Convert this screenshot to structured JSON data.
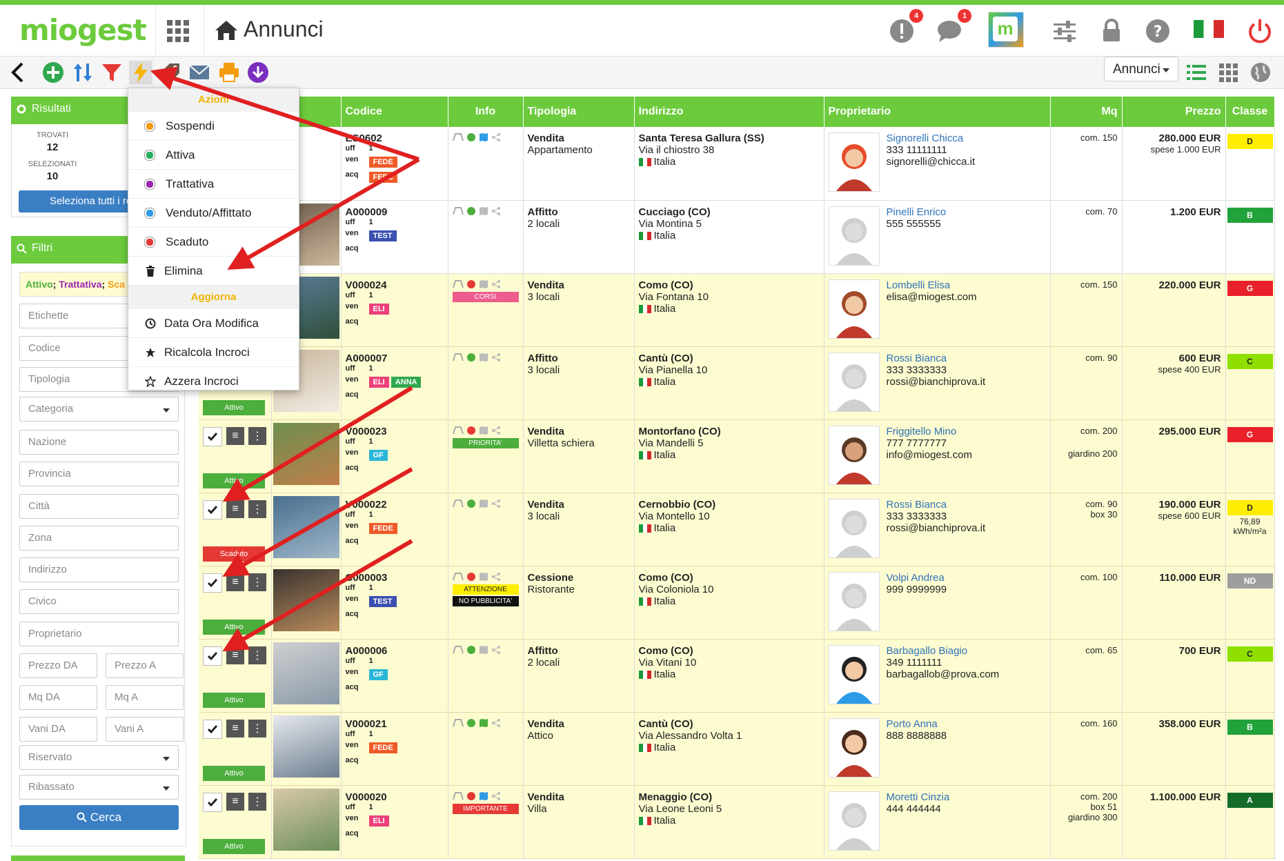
{
  "app": {
    "logo": "miogest",
    "page_title": "Annunci"
  },
  "header": {
    "alerts_badge": "4",
    "messages_badge": "1"
  },
  "toolbar": {
    "view_select": "Annunci"
  },
  "results": {
    "title": "Risultati",
    "found_label": "TROVATI",
    "found_value": "12",
    "selected_label": "SELEZIONATI",
    "selected_value": "10",
    "select_all_button": "Seleziona tutti i recor"
  },
  "filters": {
    "title": "Filtri",
    "states_active": "Attivo",
    "states_sep1": "; ",
    "states_trattativa": "Trattativa",
    "states_sep2": "; ",
    "states_scaduto": "Sca",
    "etichette": "Etichette",
    "codice": "Codice",
    "tipologia": "Tipologia",
    "categoria": "Categoria",
    "nazione": "Nazione",
    "provincia": "Provincia",
    "citta": "Città",
    "zona": "Zona",
    "indirizzo": "Indirizzo",
    "civico": "Civico",
    "proprietario": "Proprietario",
    "prezzo_da": "Prezzo DA",
    "prezzo_a": "Prezzo A",
    "mq_da": "Mq DA",
    "mq_a": "Mq A",
    "vani_da": "Vani DA",
    "vani_a": "Vani A",
    "riservato": "Riservato",
    "ribassato": "Ribassato",
    "search_button": "Cerca"
  },
  "dropdown": {
    "azioni_header": "Azioni",
    "items": [
      {
        "label": "Sospendi",
        "color": "#f39c12"
      },
      {
        "label": "Attiva",
        "color": "#27ae60"
      },
      {
        "label": "Trattativa",
        "color": "#9b27b0"
      },
      {
        "label": "Venduto/Affittato",
        "color": "#2e9be6"
      },
      {
        "label": "Scaduto",
        "color": "#e53935"
      },
      {
        "label": "Elimina"
      }
    ],
    "aggiorna_header": "Aggiorna",
    "aggiorna_items": [
      "Data Ora Modifica",
      "Ricalcola Incroci",
      "Azzera Incroci"
    ]
  },
  "table": {
    "columns": [
      "Foto",
      "Codice",
      "Info",
      "Tipologia",
      "Indirizzo",
      "Proprietario",
      "Mq",
      "Prezzo",
      "Classe"
    ],
    "uff_label": "uff",
    "ven_label": "ven",
    "acq_label": "acq",
    "rows": [
      {
        "code": "ES0602",
        "uff": "1",
        "ven_tag": "FEDE",
        "ven_color": "#f05a28",
        "acq_tag": "FEDE",
        "info_label": "",
        "tipo": "Vendita",
        "sub": "Appartamento",
        "city": "Santa Teresa Gallura (SS)",
        "street": "Via il chiostro 38",
        "country": "Italia",
        "owner": "Signorelli Chicca",
        "phone": "333 11111111",
        "email": "signorelli@chicca.it",
        "mq1": "com. 150",
        "mq2": "",
        "price": "280.000 EUR",
        "price2": "spese 1.000 EUR",
        "classe": "D",
        "classe_color": "#ffee00",
        "classe_text": "#222",
        "state": "",
        "white": true
      },
      {
        "code": "A000009",
        "uff": "1",
        "ven_tag": "TEST",
        "ven_color": "#3a4fb0",
        "acq_tag": "",
        "info_label": "",
        "tipo": "Affitto",
        "sub": "2 locali",
        "city": "Cucciago (CO)",
        "street": "Via Montina 5",
        "country": "Italia",
        "owner": "Pinelli Enrico",
        "phone": "555 555555",
        "email": "",
        "mq1": "com. 70",
        "mq2": "",
        "price": "1.200 EUR",
        "price2": "",
        "classe": "B",
        "classe_color": "#22a23a",
        "classe_text": "#fff",
        "state": "",
        "white": true
      },
      {
        "code": "V000024",
        "uff": "1",
        "ven_tag": "ELI",
        "ven_color": "#ec407a",
        "acq_tag": "",
        "info_label": "CORSI",
        "info_color": "#ec5c8c",
        "tipo": "Vendita",
        "sub": "3 locali",
        "city": "Como (CO)",
        "street": "Via Fontana 10",
        "country": "Italia",
        "owner": "Lombelli Elisa",
        "phone": "elisa@miogest.com",
        "email": "",
        "mq1": "com. 150",
        "mq2": "",
        "price": "220.000 EUR",
        "price2": "",
        "classe": "G",
        "classe_color": "#e8212a",
        "classe_text": "#fff",
        "state": ""
      },
      {
        "code": "A000007",
        "uff": "1",
        "ven_tag": "ELI",
        "ven_color": "#ec407a",
        "ven_tag2": "ANNA",
        "acq_tag": "",
        "info_label": "",
        "tipo": "Affitto",
        "sub": "3 locali",
        "city": "Cantù (CO)",
        "street": "Via Pianella 10",
        "country": "Italia",
        "owner": "Rossi Bianca",
        "phone": "333 3333333",
        "email": "rossi@bianchiprova.it",
        "mq1": "com. 90",
        "mq2": "",
        "price": "600 EUR",
        "price2": "spese 400 EUR",
        "classe": "C",
        "classe_color": "#8fe000",
        "classe_text": "#222",
        "state": "Attivo",
        "state_color": "#4cae3c"
      },
      {
        "code": "V000023",
        "uff": "1",
        "ven_tag": "GF",
        "ven_color": "#29b6d8",
        "acq_tag": "",
        "info_label": "PRIORITA'",
        "info_color": "#4cae3c",
        "tipo": "Vendita",
        "sub": "Villetta schiera",
        "city": "Montorfano (CO)",
        "street": "Via Mandelli 5",
        "country": "Italia",
        "owner": "Friggitello Mino",
        "phone": "777 7777777",
        "email": "info@miogest.com",
        "mq1": "com. 200",
        "mq2": "giardino 200",
        "price": "295.000 EUR",
        "price2": "",
        "classe": "G",
        "classe_color": "#e8212a",
        "classe_text": "#fff",
        "state": "Attivo",
        "state_color": "#4cae3c"
      },
      {
        "code": "V000022",
        "uff": "1",
        "ven_tag": "FEDE",
        "ven_color": "#f05a28",
        "acq_tag": "",
        "info_label": "",
        "tipo": "Vendita",
        "sub": "3 locali",
        "city": "Cernobbio (CO)",
        "street": "Via Montello 10",
        "country": "Italia",
        "owner": "Rossi Bianca",
        "phone": "333 3333333",
        "email": "rossi@bianchiprova.it",
        "mq1": "com. 90",
        "mq2": "box 30",
        "price": "190.000 EUR",
        "price2": "spese 600 EUR",
        "classe": "D",
        "classe_color": "#ffee00",
        "classe_text": "#222",
        "classe_extra": "76,89",
        "classe_extra2": "kWh/m²a",
        "state": "Scaduto",
        "state_color": "#e53935"
      },
      {
        "code": "C000003",
        "uff": "1",
        "ven_tag": "TEST",
        "ven_color": "#3a4fb0",
        "acq_tag": "",
        "info_label": "ATTENZIONE",
        "info_color": "#ffee00",
        "info_text": "#222",
        "info_label2": "NO PUBBLICITA'",
        "tipo": "Cessione",
        "sub": "Ristorante",
        "city": "Como (CO)",
        "street": "Via Coloniola 10",
        "country": "Italia",
        "owner": "Volpi Andrea",
        "phone": "999 9999999",
        "email": "",
        "mq1": "com. 100",
        "mq2": "",
        "price": "110.000 EUR",
        "price2": "",
        "classe": "ND",
        "classe_color": "#9e9e9e",
        "classe_text": "#fff",
        "state": "Attivo",
        "state_color": "#4cae3c"
      },
      {
        "code": "A000006",
        "uff": "1",
        "ven_tag": "GF",
        "ven_color": "#29b6d8",
        "acq_tag": "",
        "info_label": "",
        "tipo": "Affitto",
        "sub": "2 locali",
        "city": "Como (CO)",
        "street": "Via Vitani 10",
        "country": "Italia",
        "owner": "Barbagallo Biagio",
        "phone": "349 1111111",
        "email": "barbagallob@prova.com",
        "mq1": "com. 65",
        "mq2": "",
        "price": "700 EUR",
        "price2": "",
        "classe": "C",
        "classe_color": "#8fe000",
        "classe_text": "#222",
        "state": "Attivo",
        "state_color": "#4cae3c"
      },
      {
        "code": "V000021",
        "uff": "1",
        "ven_tag": "FEDE",
        "ven_color": "#f05a28",
        "acq_tag": "",
        "info_label": "",
        "tipo": "Vendita",
        "sub": "Attico",
        "city": "Cantù (CO)",
        "street": "Via Alessandro Volta 1",
        "country": "Italia",
        "owner": "Porto Anna",
        "phone": "888 8888888",
        "email": "",
        "mq1": "com. 160",
        "mq2": "",
        "price": "358.000 EUR",
        "price2": "",
        "classe": "B",
        "classe_color": "#22a23a",
        "classe_text": "#fff",
        "state": "Attivo",
        "state_color": "#4cae3c"
      },
      {
        "code": "V000020",
        "uff": "1",
        "ven_tag": "ELI",
        "ven_color": "#ec407a",
        "acq_tag": "",
        "info_label": "IMPORTANTE",
        "info_color": "#e53935",
        "tipo": "Vendita",
        "sub": "Villa",
        "city": "Menaggio (CO)",
        "street": "Via Leone Leoni 5",
        "country": "Italia",
        "owner": "Moretti Cinzia",
        "phone": "444 444444",
        "email": "",
        "mq1": "com. 200",
        "mq2": "box 51",
        "mq3": "giardino 300",
        "price": "1.100.000 EUR",
        "price2": "",
        "classe": "A",
        "classe_color": "#146b2a",
        "classe_text": "#fff",
        "state": "Attivo",
        "state_color": "#4cae3c"
      }
    ]
  },
  "colors": {
    "accent": "#6ccb3c",
    "link": "#2f73b8",
    "row_bg": "#fdfbd0",
    "arrow": "#e02020"
  }
}
